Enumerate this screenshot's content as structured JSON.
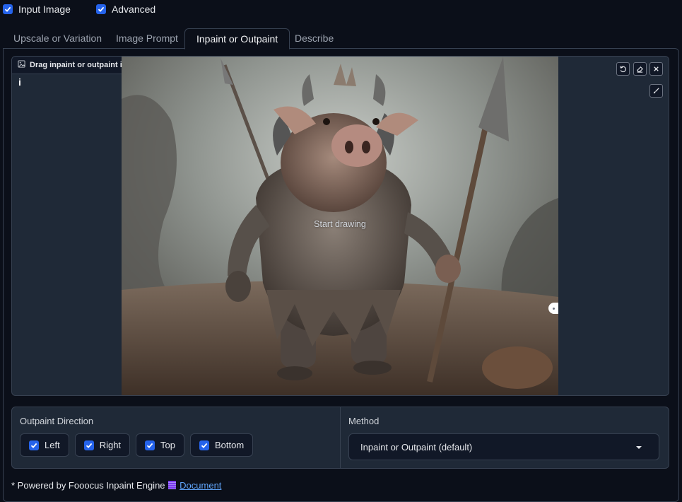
{
  "top_checkboxes": [
    {
      "label": "Input Image",
      "checked": true
    },
    {
      "label": "Advanced",
      "checked": true
    }
  ],
  "tabs": [
    {
      "label": "Upscale or Variation"
    },
    {
      "label": "Image Prompt"
    },
    {
      "label": "Inpaint or Outpaint",
      "active": true
    },
    {
      "label": "Describe"
    }
  ],
  "canvas": {
    "label": "Drag inpaint or outpaint image to here",
    "info_glyph": "i",
    "overlay_text": "Start drawing",
    "tools": [
      "undo-icon",
      "eraser-icon",
      "close-icon",
      "brush-icon"
    ]
  },
  "outpaint": {
    "title": "Outpaint Direction",
    "directions": [
      {
        "label": "Left",
        "checked": true
      },
      {
        "label": "Right",
        "checked": true
      },
      {
        "label": "Top",
        "checked": true
      },
      {
        "label": "Bottom",
        "checked": true
      }
    ]
  },
  "method": {
    "title": "Method",
    "selected": "Inpaint or Outpaint (default)"
  },
  "footer": {
    "prefix": "* Powered by Fooocus Inpaint Engine",
    "link": "Document"
  },
  "colors": {
    "background": "#0b0f19",
    "panel": "#1f2937",
    "accent": "#2563eb",
    "link": "#60a5fa"
  }
}
